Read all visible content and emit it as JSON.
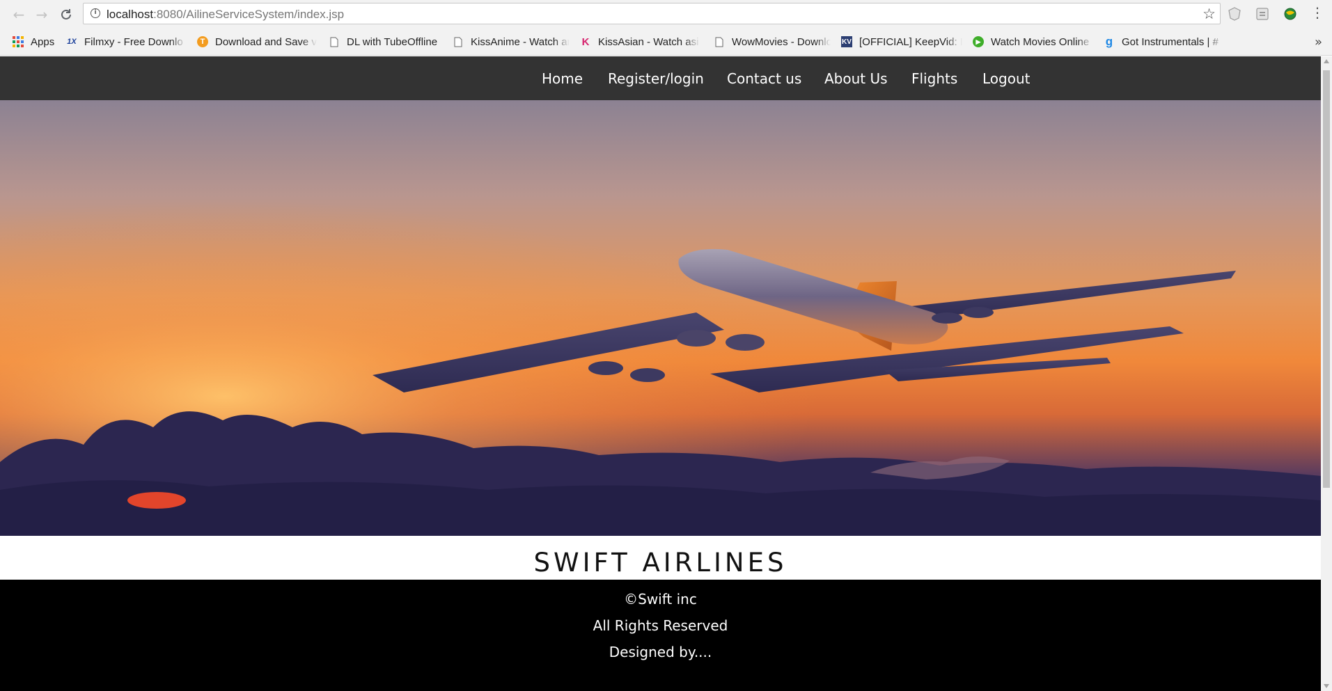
{
  "browser": {
    "url_host": "localhost",
    "url_path": ":8080/AilineServiceSystem/index.jsp",
    "bookmarks": [
      {
        "label": "Apps",
        "icon": "apps-grid-icon"
      },
      {
        "label": "Filmxy - Free Downlo",
        "icon": "filmxy-icon"
      },
      {
        "label": "Download and Save v",
        "icon": "tubeoffline-icon"
      },
      {
        "label": "DL with TubeOffline",
        "icon": "page-icon"
      },
      {
        "label": "KissAnime - Watch ar",
        "icon": "page-icon"
      },
      {
        "label": "KissAsian - Watch asi",
        "icon": "kissasian-icon"
      },
      {
        "label": "WowMovies - Downlo",
        "icon": "page-icon"
      },
      {
        "label": "[OFFICIAL] KeepVid: D",
        "icon": "keepvid-icon"
      },
      {
        "label": "Watch Movies Online",
        "icon": "play-icon"
      },
      {
        "label": "Got Instrumentals | #",
        "icon": "g-icon"
      }
    ],
    "more_label": "»"
  },
  "nav": {
    "items": [
      "Home",
      "Register/login",
      "Contact us",
      "About Us",
      "Flights",
      "Logout"
    ]
  },
  "hero": {
    "image": "airplane-sunset-image"
  },
  "brand": {
    "title": "SWIFT AIRLINES"
  },
  "footer": {
    "copyright": "©Swift inc",
    "rights": "All Rights Reserved",
    "designed": "Designed by...."
  },
  "colors": {
    "nav_bg": "#333333",
    "footer_bg": "#000000",
    "sky_top": "#8a7f93",
    "sky_glow": "#f08a3a"
  }
}
